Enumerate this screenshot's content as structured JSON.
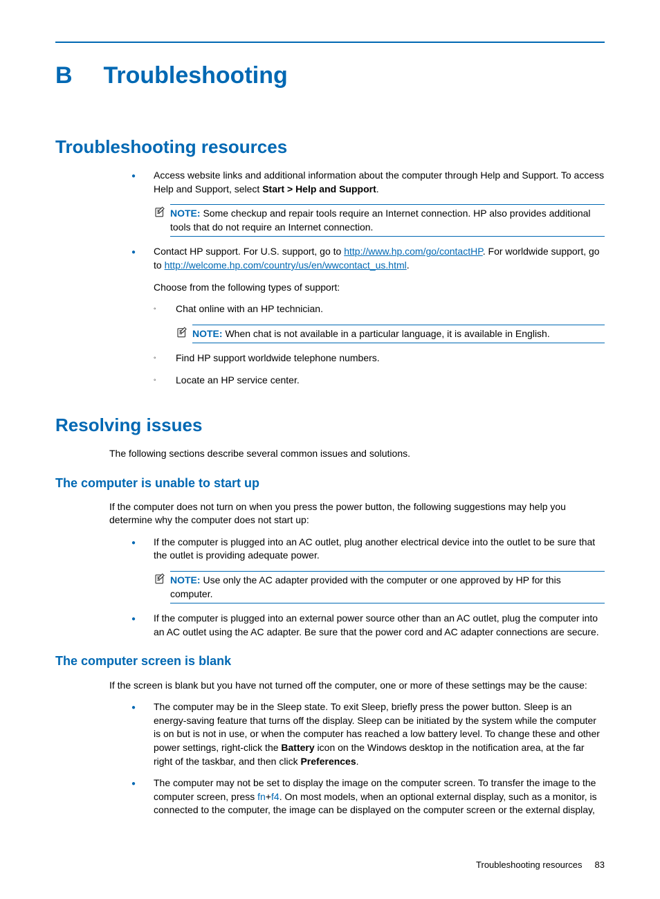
{
  "chapter": {
    "letter": "B",
    "title": "Troubleshooting"
  },
  "h_resources": "Troubleshooting resources",
  "res_b1_part1": "Access website links and additional information about the computer through Help and Support. To access Help and Support, select ",
  "res_b1_bold": "Start > Help and Support",
  "res_b1_part2": ".",
  "res_note1_label": "NOTE:",
  "res_note1_text": "Some checkup and repair tools require an Internet connection. HP also provides additional tools that do not require an Internet connection.",
  "res_b2_part1": "Contact HP support. For U.S. support, go to ",
  "res_b2_link1": "http://www.hp.com/go/contactHP",
  "res_b2_part2": ". For worldwide support, go to ",
  "res_b2_link2": "http://welcome.hp.com/country/us/en/wwcontact_us.html",
  "res_b2_part3": ".",
  "res_choose": "Choose from the following types of support:",
  "res_sub1": "Chat online with an HP technician.",
  "res_note2_label": "NOTE:",
  "res_note2_text": "When chat is not available in a particular language, it is available in English.",
  "res_sub2": "Find HP support worldwide telephone numbers.",
  "res_sub3": "Locate an HP service center.",
  "h_resolving": "Resolving issues",
  "resolving_intro": "The following sections describe several common issues and solutions.",
  "h_unable": "The computer is unable to start up",
  "unable_intro": "If the computer does not turn on when you press the power button, the following suggestions may help you determine why the computer does not start up:",
  "unable_b1": "If the computer is plugged into an AC outlet, plug another electrical device into the outlet to be sure that the outlet is providing adequate power.",
  "unable_note_label": "NOTE:",
  "unable_note_text": "Use only the AC adapter provided with the computer or one approved by HP for this computer.",
  "unable_b2": "If the computer is plugged into an external power source other than an AC outlet, plug the computer into an AC outlet using the AC adapter. Be sure that the power cord and AC adapter connections are secure.",
  "h_blank": "The computer screen is blank",
  "blank_intro": "If the screen is blank but you have not turned off the computer, one or more of these settings may be the cause:",
  "blank_b1_part1": "The computer may be in the Sleep state. To exit Sleep, briefly press the power button. Sleep is an energy-saving feature that turns off the display. Sleep can be initiated by the system while the computer is on but is not in use, or when the computer has reached a low battery level. To change these and other power settings, right-click the ",
  "blank_b1_bold1": "Battery",
  "blank_b1_part2": " icon on the Windows desktop in the notification area, at the far right of the taskbar, and then click ",
  "blank_b1_bold2": "Preferences",
  "blank_b1_part3": ".",
  "blank_b2_part1": "The computer may not be set to display the image on the computer screen. To transfer the image to the computer screen, press ",
  "blank_b2_key1": "fn",
  "blank_b2_plus": "+",
  "blank_b2_key2": "f4",
  "blank_b2_part2": ". On most models, when an optional external display, such as a monitor, is connected to the computer, the image can be displayed on the computer screen or the external display,",
  "footer": {
    "section": "Troubleshooting resources",
    "page": "83"
  }
}
